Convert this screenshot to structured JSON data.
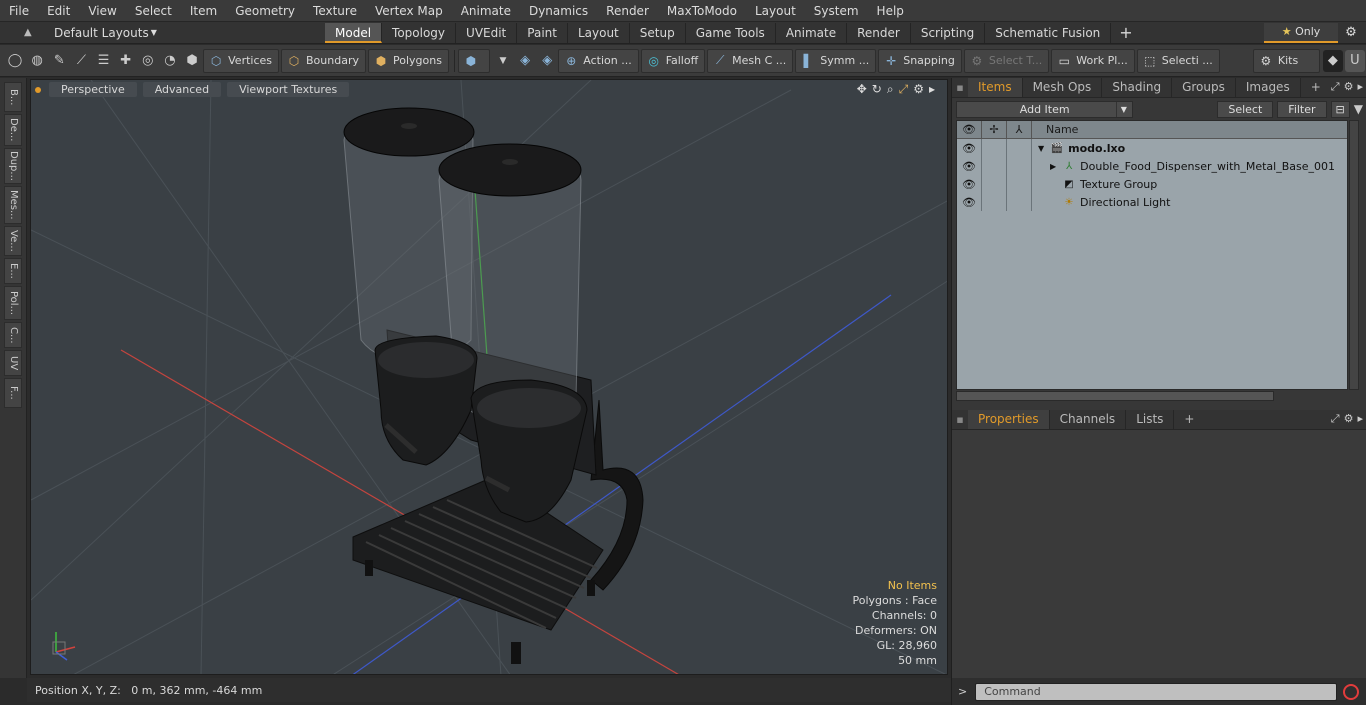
{
  "menu": [
    "File",
    "Edit",
    "View",
    "Select",
    "Item",
    "Geometry",
    "Texture",
    "Vertex Map",
    "Animate",
    "Dynamics",
    "Render",
    "MaxToModo",
    "Layout",
    "System",
    "Help"
  ],
  "layout_selector": "Default Layouts",
  "layout_tabs": [
    {
      "label": "Model",
      "active": true
    },
    {
      "label": "Topology"
    },
    {
      "label": "UVEdit"
    },
    {
      "label": "Paint"
    },
    {
      "label": "Layout"
    },
    {
      "label": "Setup"
    },
    {
      "label": "Game Tools"
    },
    {
      "label": "Animate"
    },
    {
      "label": "Render"
    },
    {
      "label": "Scripting"
    },
    {
      "label": "Schematic Fusion"
    }
  ],
  "only_label": "Only",
  "toolbar": {
    "vertices": "Vertices",
    "boundary": "Boundary",
    "polygons": "Polygons",
    "action": "Action ...",
    "falloff": "Falloff",
    "mesh": "Mesh C ...",
    "symm": "Symm ...",
    "snapping": "Snapping",
    "select_t": "Select T...",
    "workpl": "Work Pl...",
    "selecti": "Selecti ...",
    "kits": "Kits"
  },
  "left_tabs": [
    "B...",
    "De...",
    "Dup...",
    "Mes...",
    "Ve...",
    "E...",
    "Pol...",
    "C...",
    "UV",
    "F..."
  ],
  "viewport": {
    "tabs": [
      "Perspective",
      "Advanced",
      "Viewport Textures"
    ],
    "info": {
      "items": "No Items",
      "polygons": "Polygons : Face",
      "channels": "Channels: 0",
      "deformers": "Deformers: ON",
      "gl": "GL: 28,960",
      "scale": "50 mm"
    }
  },
  "status": "Position X, Y, Z:   0 m, 362 mm, -464 mm",
  "items_panel": {
    "tabs": [
      {
        "label": "Items",
        "active": true
      },
      {
        "label": "Mesh Ops"
      },
      {
        "label": "Shading"
      },
      {
        "label": "Groups"
      },
      {
        "label": "Images"
      }
    ],
    "add_item": "Add Item",
    "select": "Select",
    "filter": "Filter",
    "name_header": "Name",
    "rows": [
      {
        "name": "modo.lxo",
        "bold": true
      },
      {
        "name": "Double_Food_Dispenser_with_Metal_Base_001"
      },
      {
        "name": "Texture Group"
      },
      {
        "name": "Directional Light"
      }
    ]
  },
  "properties_panel": {
    "tabs": [
      {
        "label": "Properties",
        "active": true
      },
      {
        "label": "Channels"
      },
      {
        "label": "Lists"
      }
    ]
  },
  "command_placeholder": "Command",
  "colors": {
    "accent": "#e19a2a",
    "axis_x": "#d2433d",
    "axis_y": "#3fbf3f",
    "axis_z": "#3f5fd8"
  }
}
